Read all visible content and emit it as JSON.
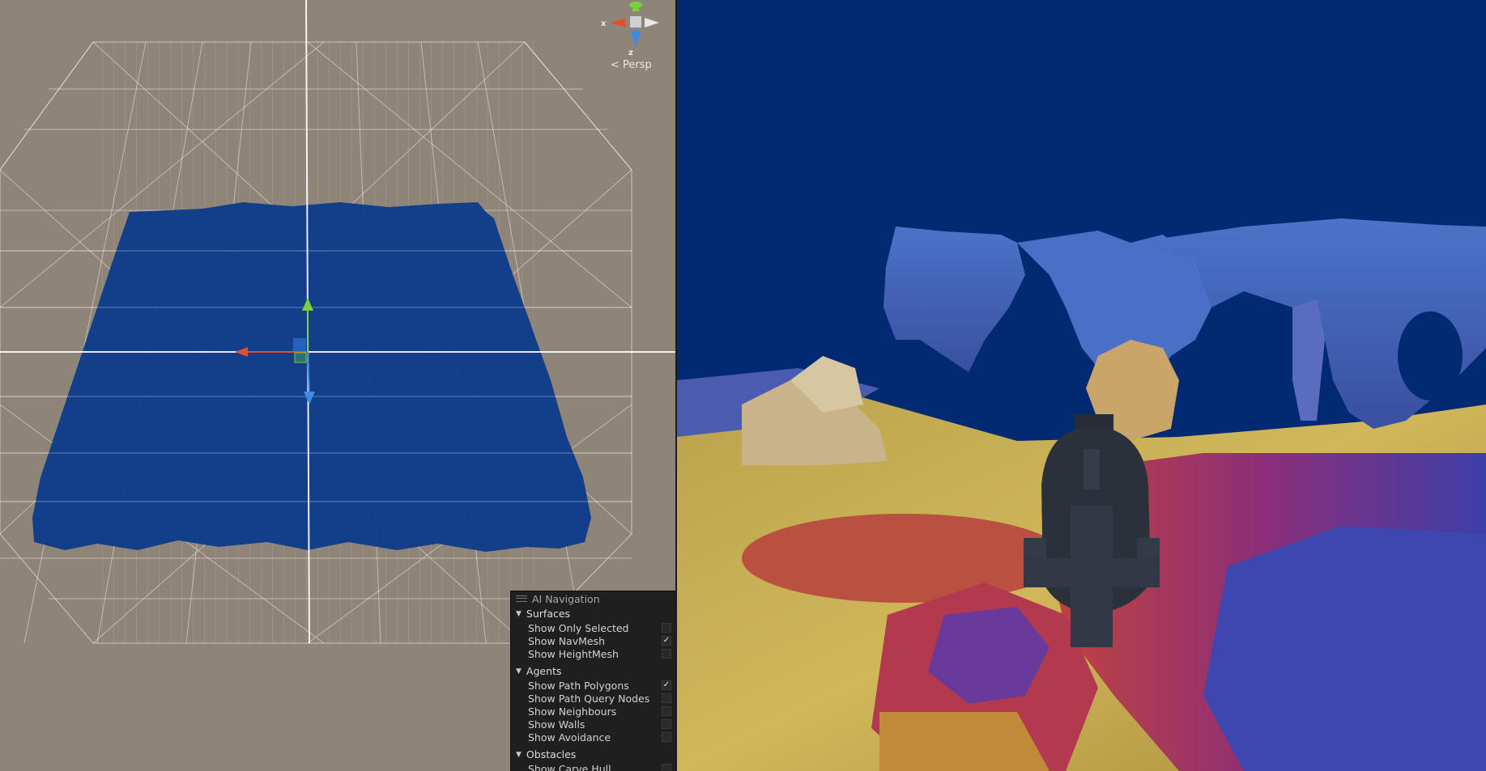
{
  "scene_view": {
    "persp_label": "Persp",
    "axis_labels": {
      "x": "x",
      "z": "z"
    },
    "navmesh_color": "#0d3a8a"
  },
  "ai_navigation": {
    "title": "AI Navigation",
    "sections": [
      {
        "label": "Surfaces",
        "items": [
          {
            "label": "Show Only Selected",
            "checked": false
          },
          {
            "label": "Show NavMesh",
            "checked": true
          },
          {
            "label": "Show HeightMesh",
            "checked": false
          }
        ]
      },
      {
        "label": "Agents",
        "items": [
          {
            "label": "Show Path Polygons",
            "checked": true
          },
          {
            "label": "Show Path Query Nodes",
            "checked": false
          },
          {
            "label": "Show Neighbours",
            "checked": false
          },
          {
            "label": "Show Walls",
            "checked": false
          },
          {
            "label": "Show Avoidance",
            "checked": false
          }
        ]
      },
      {
        "label": "Obstacles",
        "items": [
          {
            "label": "Show Carve Hull",
            "checked": false
          }
        ]
      }
    ],
    "checkmark": "✓"
  },
  "game_view": {
    "sky_color": "#022a73"
  }
}
